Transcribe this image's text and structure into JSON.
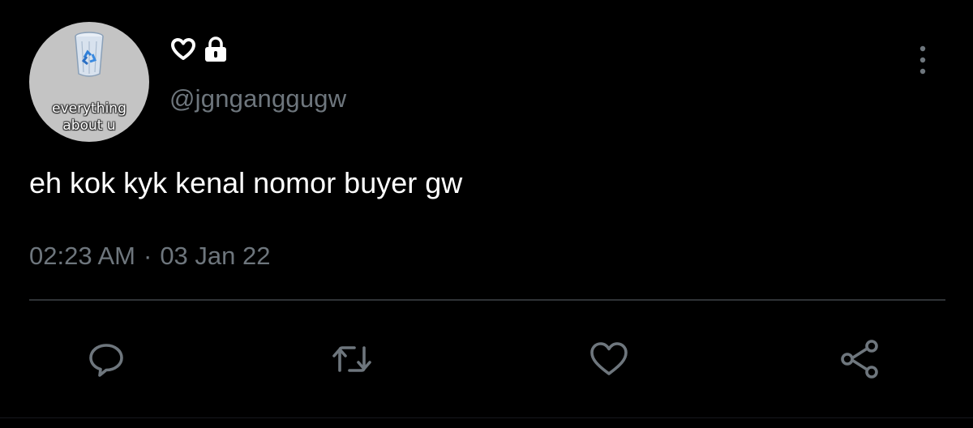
{
  "profile": {
    "avatar_caption_line1": "everything",
    "avatar_caption_line2": "about u",
    "handle": "@jgnganggugw",
    "badges": [
      "heart-outline-icon",
      "lock-icon"
    ]
  },
  "tweet": {
    "text": "eh kok kyk kenal nomor buyer gw",
    "time": "02:23 AM",
    "separator": "·",
    "date": "03 Jan 22"
  },
  "actions": [
    "reply-icon",
    "retweet-icon",
    "like-icon",
    "share-icon"
  ],
  "colors": {
    "background": "#000000",
    "text": "#ffffff",
    "muted": "#6e767d",
    "divider": "#2f3336",
    "avatar_bg": "#c4c4c4"
  }
}
